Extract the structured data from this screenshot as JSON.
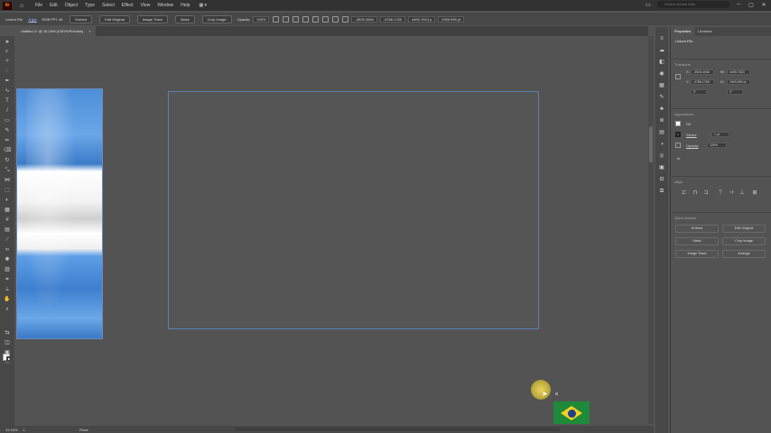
{
  "app": {
    "logo": "Ai",
    "menu": [
      "File",
      "Edit",
      "Object",
      "Type",
      "Select",
      "Effect",
      "View",
      "Window",
      "Help"
    ],
    "search_placeholder": "Search Adobe Help"
  },
  "controlbar": {
    "object_type": "Linked File",
    "filename": "A.jpg",
    "color_info": "RGB  PPI: 46",
    "embed": "Embed",
    "edit_original": "Edit Original",
    "image_trace": "Image Trace",
    "mask": "Mask",
    "crop_image": "Crop Image",
    "opacity_label": "Opacity:",
    "opacity_value": "100%",
    "x_value": "-3926.4046",
    "y_value": "-3786.1789",
    "w_value": "4490.7623 p",
    "h_value": "2909.899 pt"
  },
  "document": {
    "tab_title": "Untitled-1* @ 15.16% (CMYK/Preview)",
    "close": "×"
  },
  "statusbar": {
    "zoom": "15.16%",
    "artboard": "1",
    "tool": "Place"
  },
  "panel": {
    "tabs": [
      "Properties",
      "Libraries"
    ],
    "object_type": "Linked File",
    "transform_title": "Transform",
    "x_label": "X:",
    "x_value": "-3926.4046",
    "y_label": "Y:",
    "y_value": "-3786.1789",
    "w_label": "W:",
    "w_value": "4490.7623",
    "h_label": "H:",
    "h_value": "2909.899 pt",
    "angle": "0°",
    "appearance_title": "Appearance",
    "fill_label": "Fill",
    "stroke_label": "Stroke",
    "stroke_value": "1 pt",
    "opacity_label": "Opacity",
    "opacity_value": "100%",
    "fx": "fx.",
    "align_title": "Align",
    "quick_actions_title": "Quick Actions",
    "quick_actions": [
      "Embed",
      "Edit Original",
      "Mask",
      "Crop Image",
      "Image Trace",
      "Arrange"
    ]
  },
  "cursor_tag": "⊞"
}
